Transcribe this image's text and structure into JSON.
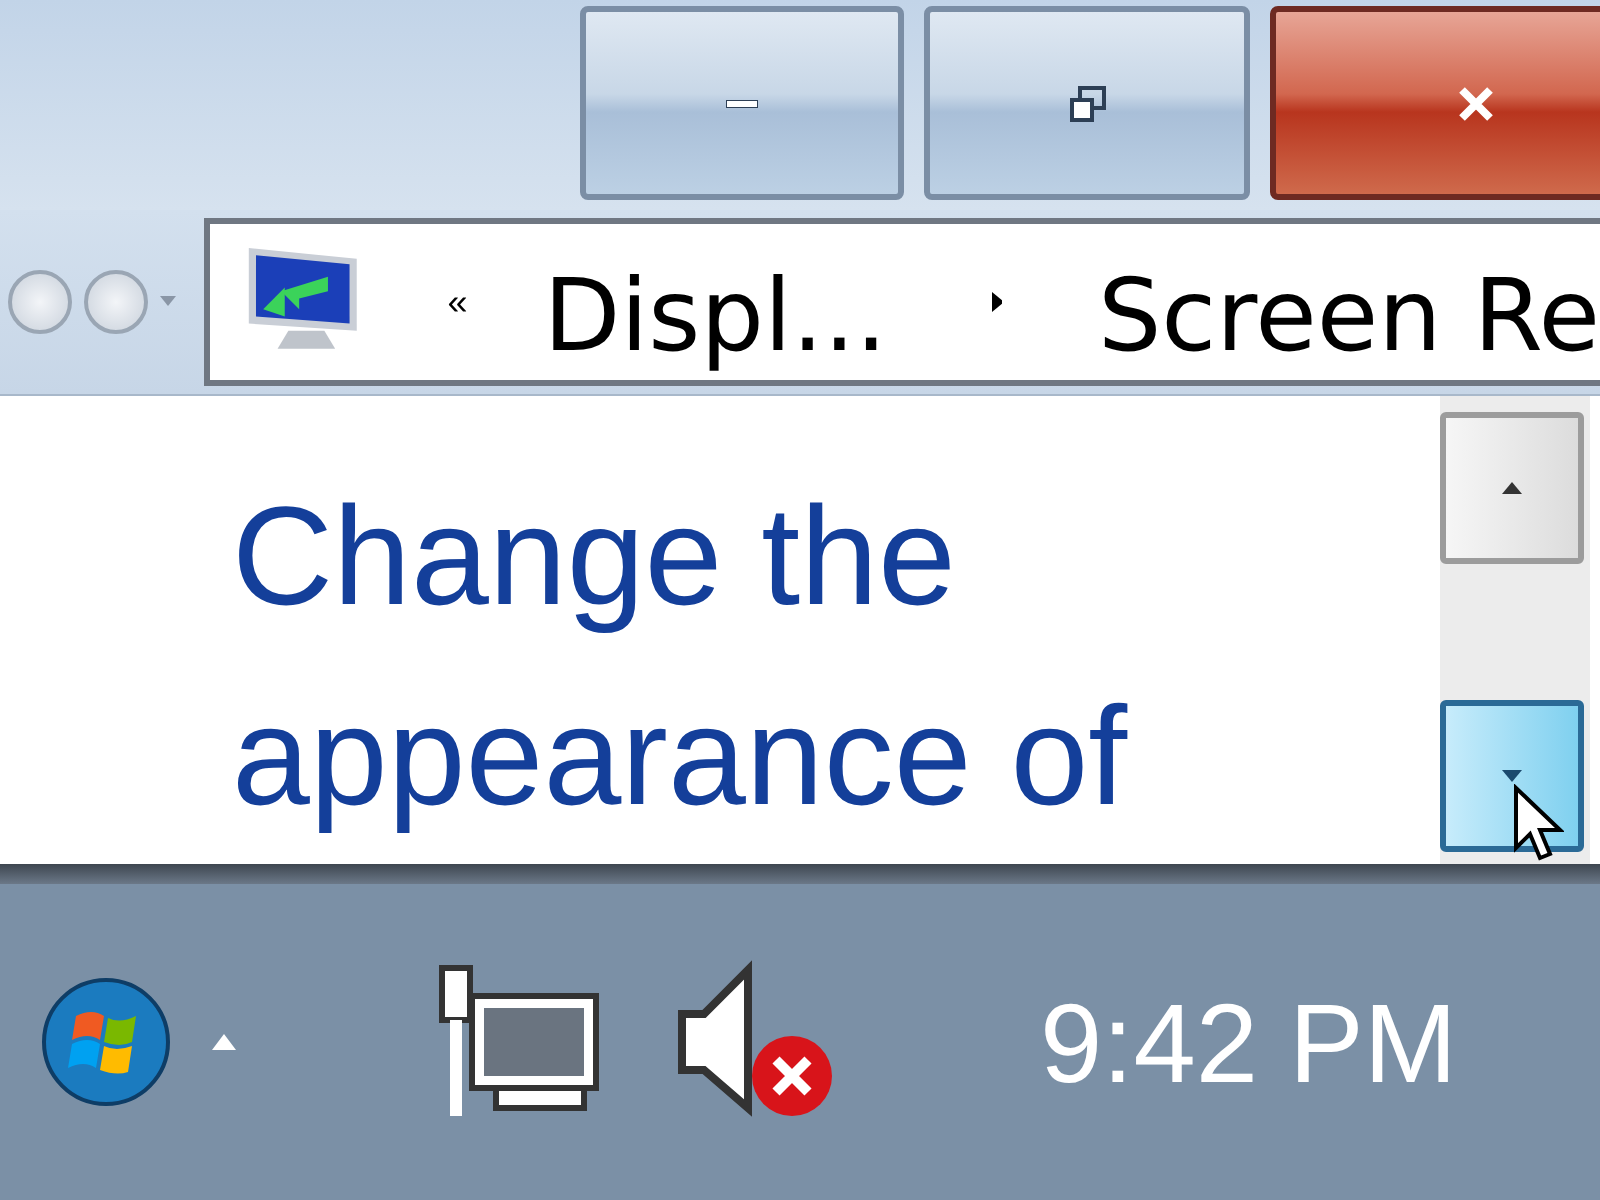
{
  "window": {
    "controls": [
      {
        "kind": "minimize"
      },
      {
        "kind": "maximize"
      },
      {
        "kind": "close"
      }
    ]
  },
  "address_bar": {
    "overflow": "«",
    "crumbs": [
      "Displ...",
      "Screen Re"
    ]
  },
  "content": {
    "heading": "Change the appearance of"
  },
  "taskbar": {
    "volume": {
      "muted": true
    },
    "clock": "9:42 PM"
  }
}
